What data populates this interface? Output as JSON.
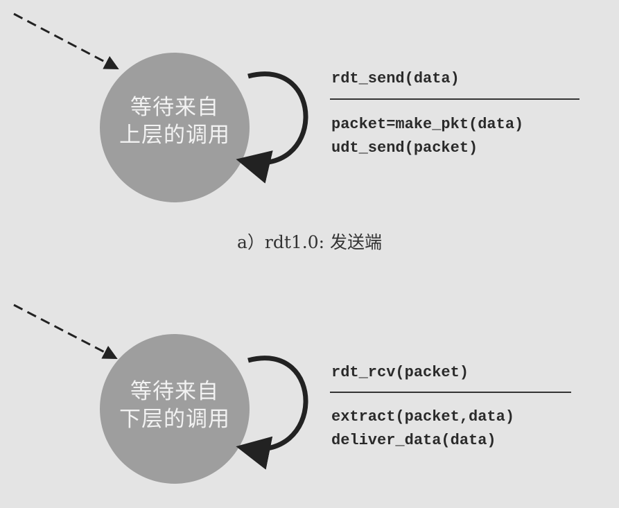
{
  "sender": {
    "state_line1": "等待来自",
    "state_line2": "上层的调用",
    "event": "rdt_send(data)",
    "actions": [
      "packet=make_pkt(data)",
      "udt_send(packet)"
    ],
    "caption": "a）rdt1.0: 发送端"
  },
  "receiver": {
    "state_line1": "等待来自",
    "state_line2": "下层的调用",
    "event": "rdt_rcv(packet)",
    "actions": [
      "extract(packet,data)",
      "deliver_data(data)"
    ]
  },
  "colors": {
    "state_fill": "#9e9e9e",
    "arrow": "#222222",
    "background": "#e4e4e4"
  }
}
